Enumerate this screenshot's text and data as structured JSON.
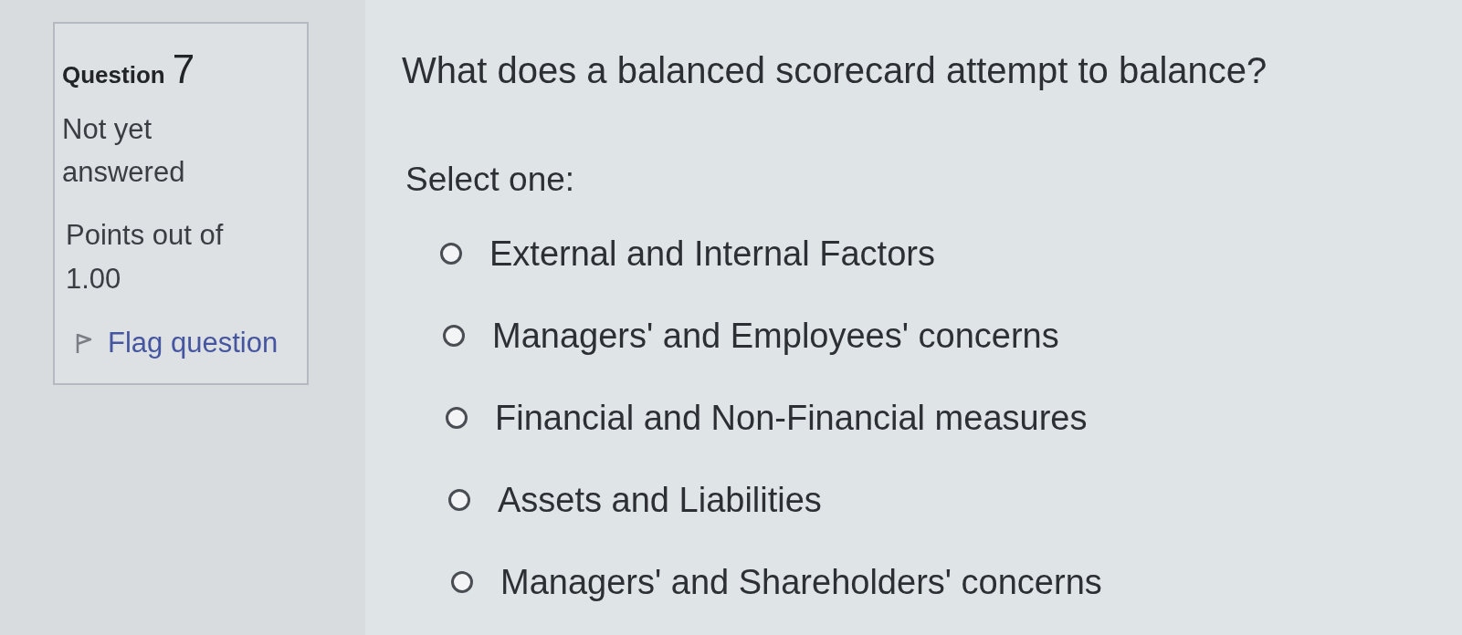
{
  "question_info": {
    "label": "Question",
    "number": "7",
    "status": "Not yet answered",
    "points": "Points out of 1.00",
    "flag_link": {
      "text": "Flag question",
      "flagged": false
    }
  },
  "question": {
    "text": "What does a balanced scorecard attempt to balance?",
    "prompt": "Select one:",
    "options": [
      {
        "label": "External and Internal Factors",
        "selected": false
      },
      {
        "label": "Managers' and Employees' concerns",
        "selected": false
      },
      {
        "label": "Financial and Non-Financial measures",
        "selected": false
      },
      {
        "label": "Assets and Liabilities",
        "selected": false
      },
      {
        "label": "Managers' and Shareholders' concerns",
        "selected": false
      }
    ]
  }
}
